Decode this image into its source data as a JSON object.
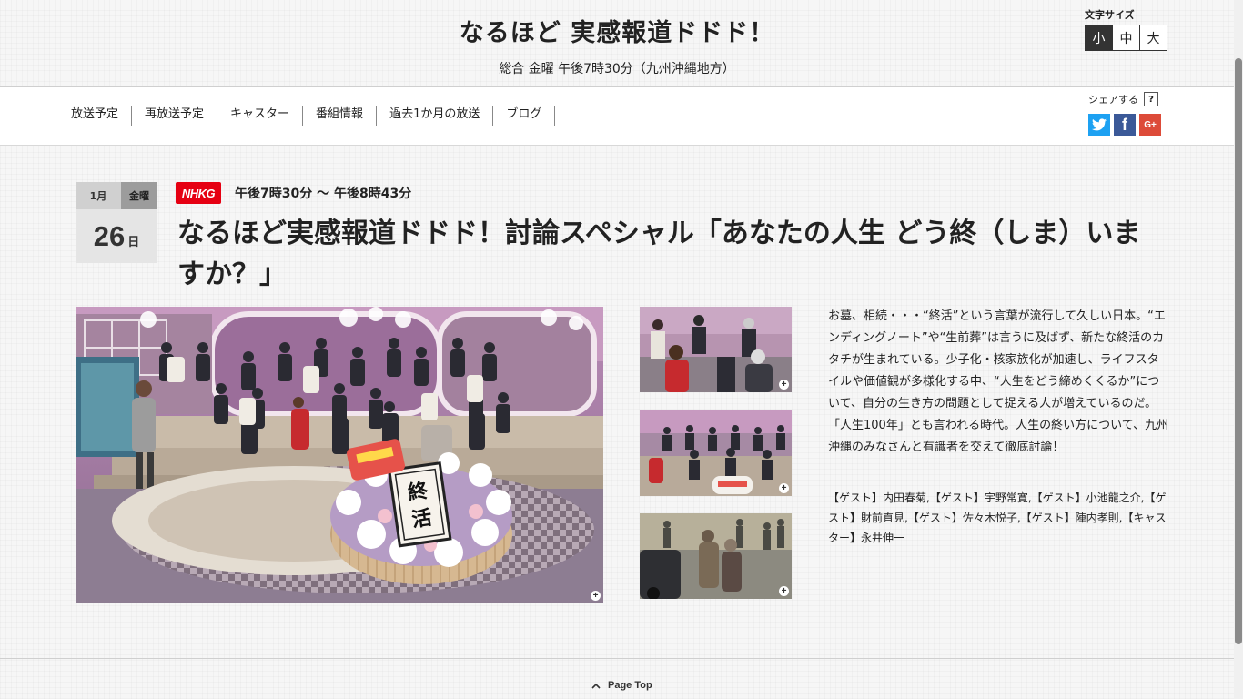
{
  "header": {
    "title": "なるほど 実感報道ドドド！",
    "subtitle": "総合 金曜 午後7時30分（九州沖縄地方）",
    "font_size": {
      "label": "文字サイズ",
      "options": [
        "小",
        "中",
        "大"
      ],
      "selected": "小"
    }
  },
  "nav": {
    "items": [
      "放送予定",
      "再放送予定",
      "キャスター",
      "番組情報",
      "過去1か月の放送",
      "ブログ"
    ]
  },
  "share": {
    "label": "シェアする",
    "help": "?",
    "services": [
      "twitter-icon",
      "facebook-icon",
      "google-plus-icon"
    ],
    "fb_glyph": "f",
    "gp_glyph": "G+"
  },
  "episode": {
    "month": "1月",
    "weekday": "金曜",
    "day": "26",
    "day_unit": "日",
    "channel": "NHKG",
    "time": "午後7時30分 〜 午後8時43分",
    "title": "なるほど実感報道ドドド！討論スペシャル「あなたの人生 どう終（しま）いますか？」",
    "description": "お墓、相続・・・“終活”という言葉が流行して久しい日本。“エンディングノート”や“生前葬”は言うに及ばず、新たな終活のカタチが生まれている。少子化・核家族化が加速し、ライフスタイルや価値観が多様化する中、“人生をどう締めくくるか”について、自分の生き方の問題として捉える人が増えているのだ。「人生100年」とも言われる時代。人生の終い方について、九州沖縄のみなさんと有識者を交えて徹底討論！",
    "guests": "【ゲスト】内田春菊,【ゲスト】宇野常寛,【ゲスト】小池龍之介,【ゲスト】財前直見,【ゲスト】佐々木悦子,【ゲスト】陣内孝則,【キャスター】永井伸一",
    "main_image_sign": "終活",
    "zoom_glyph": "+"
  },
  "footer": {
    "page_top": "Page Top"
  },
  "colors": {
    "nhk_red": "#e60012",
    "twitter": "#1da1f2",
    "facebook": "#3b5998",
    "google_plus": "#dd4b39"
  }
}
